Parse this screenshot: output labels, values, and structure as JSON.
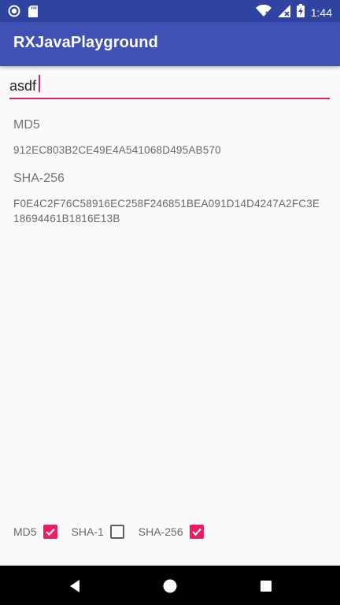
{
  "status_bar": {
    "time": "1:44",
    "icons": [
      "notification-circle-icon",
      "sd-card-icon",
      "wifi-icon",
      "signal-icon",
      "battery-charging-icon"
    ]
  },
  "app_bar": {
    "title": "RXJavaPlayground"
  },
  "input": {
    "value": "asdf"
  },
  "results": [
    {
      "label": "MD5",
      "value": "912EC803B2CE49E4A541068D495AB570"
    },
    {
      "label": "SHA-256",
      "value": "F0E4C2F76C58916EC258F246851BEA091D14D4247A2FC3E18694461B1816E13B"
    }
  ],
  "checkboxes": [
    {
      "label": "MD5",
      "checked": true
    },
    {
      "label": "SHA-1",
      "checked": false
    },
    {
      "label": "SHA-256",
      "checked": true
    }
  ],
  "colors": {
    "status_bar": "#2f43a0",
    "app_bar": "#3f51b5",
    "accent": "#e91e63",
    "background": "#fafafa"
  },
  "nav_bar": {
    "buttons": [
      "back-icon",
      "home-icon",
      "recents-icon"
    ]
  }
}
